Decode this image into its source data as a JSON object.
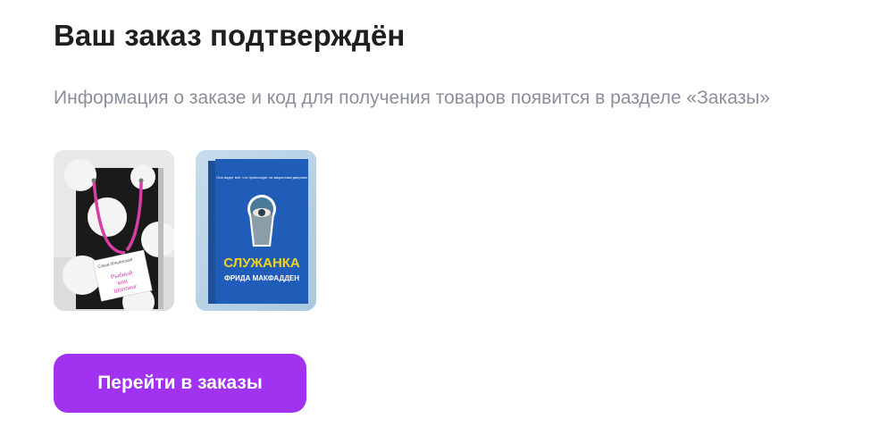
{
  "confirmation": {
    "title": "Ваш заказ подтверждён",
    "subtitle": "Информация о заказе и код для получения товаров появится в разделе «Заказы»"
  },
  "products": [
    {
      "image": "book-cover-shopping-bag",
      "cover_tag_lines": [
        "Рыбный",
        "или",
        "Шоппинг"
      ],
      "cover_author": "Саша Ильинская"
    },
    {
      "image": "book-cover-sluzhanka",
      "cover_title": "СЛУЖАНКА",
      "cover_author": "ФРИДА МАКФАДДЕН",
      "cover_tagline": "Она видит всё, что происходит за закрытыми дверями"
    }
  ],
  "actions": {
    "go_to_orders_label": "Перейти в заказы"
  },
  "colors": {
    "accent": "#a032f0",
    "title_text": "#1f1f1f",
    "subtitle_text": "#8a8f99"
  }
}
